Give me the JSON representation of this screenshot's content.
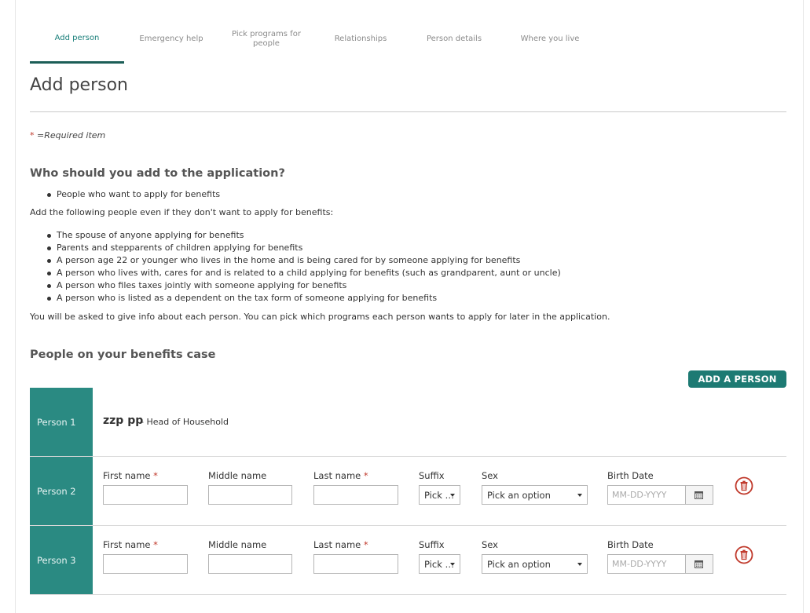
{
  "tabs": [
    {
      "label_line1": "Add person",
      "label_line2": "",
      "active": true
    },
    {
      "label_line1": "Emergency help",
      "label_line2": "",
      "active": false
    },
    {
      "label_line1": "Pick programs for",
      "label_line2": "people",
      "active": false
    },
    {
      "label_line1": "Relationships",
      "label_line2": "",
      "active": false
    },
    {
      "label_line1": "Person details",
      "label_line2": "",
      "active": false
    },
    {
      "label_line1": "Where you live",
      "label_line2": "",
      "active": false
    }
  ],
  "page_title": "Add person",
  "required_note": {
    "star": "*",
    "text": "=Required item"
  },
  "who_section": {
    "heading": "Who should you add to the application?",
    "bullets_top": [
      "People who want to apply for benefits"
    ],
    "intro": "Add the following people even if they don't want to apply for benefits:",
    "bullets": [
      "The spouse of anyone applying for benefits",
      "Parents and stepparents of children applying for benefits",
      "A person age 22 or younger who lives in the home and is being cared for by someone applying for benefits",
      "A person who lives with, cares for and is related to a child applying for benefits (such as grandparent, aunt or uncle)",
      "A person who files taxes jointly with someone applying for benefits",
      "A person who is listed as a dependent on the tax form of someone applying for benefits"
    ],
    "outro": "You will be asked to give info about each person. You can pick which programs each person wants to apply for later in the application."
  },
  "people_section": {
    "heading": "People on your benefits case",
    "add_button": "ADD A PERSON"
  },
  "fields": {
    "first_name": "First name",
    "middle_name": "Middle name",
    "last_name": "Last name",
    "suffix": "Suffix",
    "sex": "Sex",
    "birth_date": "Birth Date",
    "required_star": "*",
    "suffix_value": "Pick …",
    "sex_value": "Pick an option",
    "date_placeholder": "MM-DD-YYYY"
  },
  "people": [
    {
      "label": "Person 1",
      "name": "zzp pp",
      "role": "- Head of Household"
    },
    {
      "label": "Person 2"
    },
    {
      "label": "Person 3"
    }
  ],
  "colors": {
    "accent": "#2a8a82",
    "button": "#1d7a73",
    "tab_active": "#1a7f7a",
    "required": "#c0392b",
    "delete": "#c0392b"
  },
  "icons": {
    "calendar": "calendar-icon",
    "delete": "trash-icon",
    "dropdown": "chevron-down-icon"
  }
}
